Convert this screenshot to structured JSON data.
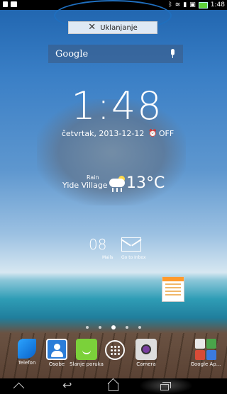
{
  "status_bar": {
    "time": "1:48",
    "left_icons": [
      "download-icon",
      "gallery-icon"
    ],
    "right_icons": [
      "bluetooth-icon",
      "wifi-icon",
      "signal-icon",
      "screenshot-icon",
      "battery-icon"
    ]
  },
  "remove_zone": {
    "label": "Uklanjanje",
    "icon": "close-icon"
  },
  "search": {
    "logo": "Google",
    "icon": "mic-icon"
  },
  "clock": {
    "time": "1:48",
    "date": "četvrtak, 2013-12-12",
    "alarm": "OFF"
  },
  "weather": {
    "condition": "Rain",
    "location": "Yide Village",
    "temperature": "13°C"
  },
  "mail_widget": {
    "count": "08",
    "label_mails": "Mails",
    "label_inbox": "Go to Inbox"
  },
  "page_indicator": {
    "pages": 5,
    "active_index": 2
  },
  "dock": {
    "apps": [
      {
        "label": "Telefon",
        "icon": "phone-icon"
      },
      {
        "label": "Osobe",
        "icon": "contacts-icon"
      },
      {
        "label": "Slanje poruka",
        "icon": "messaging-icon"
      },
      {
        "label": "",
        "icon": "all-apps-icon"
      },
      {
        "label": "Camera",
        "icon": "camera-icon"
      },
      {
        "label": "Google Ap...",
        "icon": "google-apps-folder-icon"
      }
    ]
  },
  "nav_bar": {
    "buttons": [
      "menu-caret-icon",
      "back-icon",
      "home-icon",
      "recents-icon"
    ]
  },
  "colors": {
    "highlight_oval": "#1f6fbf",
    "battery": "#5fd23a",
    "note_accent": "#ff9a2b"
  }
}
